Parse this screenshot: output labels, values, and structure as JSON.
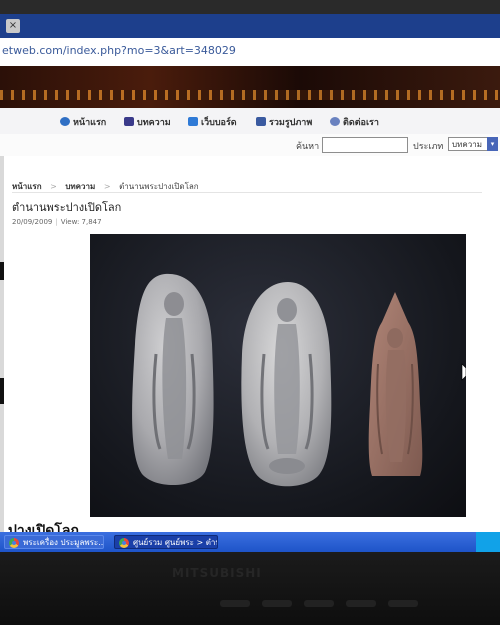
{
  "browser": {
    "tab_close_glyph": "×",
    "url": "etweb.com/index.php?mo=3&art=348029"
  },
  "nav": {
    "items": [
      {
        "label": "หน้าแรก",
        "icon": "home-icon",
        "color": "#2f6fc4"
      },
      {
        "label": "บทความ",
        "icon": "article-icon",
        "color": "#3a3a8a"
      },
      {
        "label": "เว็บบอร์ด",
        "icon": "webboard-icon",
        "color": "#2f7ad6"
      },
      {
        "label": "รวมรูปภาพ",
        "icon": "gallery-icon",
        "color": "#3a5aa0"
      },
      {
        "label": "ติดต่อเรา",
        "icon": "contact-icon",
        "color": "#6a82c0"
      }
    ]
  },
  "search": {
    "label": "ค้นหา",
    "value": "",
    "type_label": "ประเภท",
    "type_selected": "บทความ",
    "dropdown_glyph": "▾"
  },
  "breadcrumb": {
    "home": "หน้าแรก",
    "section": "บทความ",
    "current": "ตำนานพระปางเปิดโลก",
    "separator": ">"
  },
  "article": {
    "title": "ตำนานพระปางเปิดโลก",
    "date": "20/09/2009",
    "separator": "|",
    "views": "View: 7,847",
    "subheading": "ปางเปิดโลก"
  },
  "taskbar": {
    "items": [
      {
        "label": "พระเครื่อง ประมูลพระ...",
        "state": "inactive"
      },
      {
        "label": "ศูนย์รวม ศูนย์พระ > ตำนาน...",
        "state": "active"
      }
    ],
    "accent": "#1e54c8"
  },
  "monitor": {
    "brand": "MITSUBISHI"
  }
}
